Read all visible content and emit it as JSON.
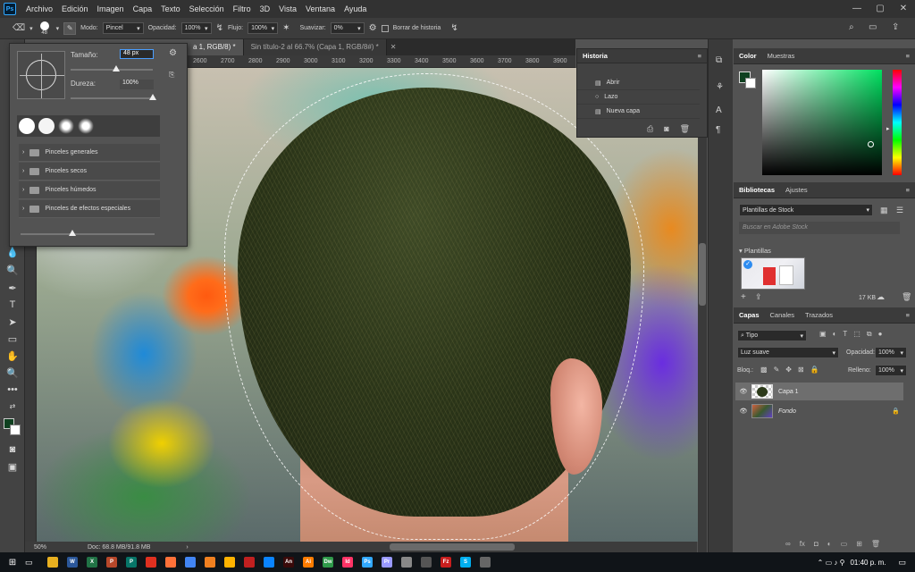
{
  "menubar": {
    "items": [
      "Archivo",
      "Edición",
      "Imagen",
      "Capa",
      "Texto",
      "Selección",
      "Filtro",
      "3D",
      "Vista",
      "Ventana",
      "Ayuda"
    ],
    "logo": "Ps"
  },
  "options": {
    "brush_size": "48",
    "modo_label": "Modo:",
    "modo_value": "Pincel",
    "opacidad_label": "Opacidad:",
    "opacidad_value": "100%",
    "flujo_label": "Flujo:",
    "flujo_value": "100%",
    "suavizar_label": "Suavizar:",
    "suavizar_value": "0%",
    "borrar_label": "Borrar de historia"
  },
  "tabs": [
    {
      "label": "a 1, RGB/8) *",
      "active": true
    },
    {
      "label": "Sin título-2 al 66.7% (Capa 1, RGB/8#) *",
      "active": false
    }
  ],
  "ruler": [
    "2600",
    "2700",
    "2800",
    "2900",
    "3000",
    "3100",
    "3200",
    "3300",
    "3400",
    "3500",
    "3600",
    "3700",
    "3800",
    "3900"
  ],
  "brush_popup": {
    "tamano_label": "Tamaño:",
    "tamano_value": "48 px",
    "dureza_label": "Dureza:",
    "dureza_value": "100%",
    "tamano_level": 0.55,
    "dureza_level": 1.0,
    "presets": [
      "Pinceles generales",
      "Pinceles secos",
      "Pinceles húmedos",
      "Pinceles de efectos especiales"
    ]
  },
  "history": {
    "title": "Historia",
    "items": [
      "Abrir",
      "Lazo",
      "Nueva capa"
    ]
  },
  "status": {
    "zoom": "50%",
    "doc": "Doc: 68.8 MB/91.8 MB"
  },
  "color_panel": {
    "tabs": [
      "Color",
      "Muestras"
    ],
    "foreground": "#0f4020",
    "background": "#ffffff"
  },
  "libraries": {
    "tabs": [
      "Bibliotecas",
      "Ajustes"
    ],
    "dropdown": "Plantillas de Stock",
    "search_placeholder": "Buscar en Adobe Stock",
    "section": "Plantillas",
    "size": "17 KB"
  },
  "layers": {
    "tabs": [
      "Capas",
      "Canales",
      "Trazados"
    ],
    "filter": "Tipo",
    "blend_mode": "Luz suave",
    "opacidad_label": "Opacidad:",
    "opacidad_value": "100%",
    "bloq_label": "Bloq.:",
    "relleno_label": "Relleno:",
    "relleno_value": "100%",
    "rows": [
      {
        "name": "Capa 1",
        "selected": true,
        "italic": false
      },
      {
        "name": "Fondo",
        "selected": false,
        "italic": true
      }
    ]
  },
  "taskbar": {
    "time": "01:40 p. m.",
    "apps": [
      {
        "label": "W",
        "color": "#2b579a"
      },
      {
        "label": "X",
        "color": "#217346"
      },
      {
        "label": "P",
        "color": "#b7472a"
      },
      {
        "label": "P",
        "color": "#077568"
      },
      {
        "label": "",
        "color": "#e03020"
      },
      {
        "label": "",
        "color": "#ff7139"
      },
      {
        "label": "",
        "color": "#4285f4"
      },
      {
        "label": "",
        "color": "#f08020"
      },
      {
        "label": "",
        "color": "#ffb300"
      },
      {
        "label": "",
        "color": "#c02020"
      },
      {
        "label": "",
        "color": "#0a84ff"
      },
      {
        "label": "An",
        "color": "#3a0a0a"
      },
      {
        "label": "Ai",
        "color": "#ff7c00"
      },
      {
        "label": "Dw",
        "color": "#2f9a4a"
      },
      {
        "label": "Id",
        "color": "#ff3366"
      },
      {
        "label": "Ps",
        "color": "#31a8ff"
      },
      {
        "label": "Pr",
        "color": "#9999ff"
      },
      {
        "label": "",
        "color": "#888"
      },
      {
        "label": "",
        "color": "#555"
      },
      {
        "label": "Fz",
        "color": "#c81e1e"
      },
      {
        "label": "S",
        "color": "#00aff0"
      },
      {
        "label": "",
        "color": "#666"
      }
    ]
  }
}
